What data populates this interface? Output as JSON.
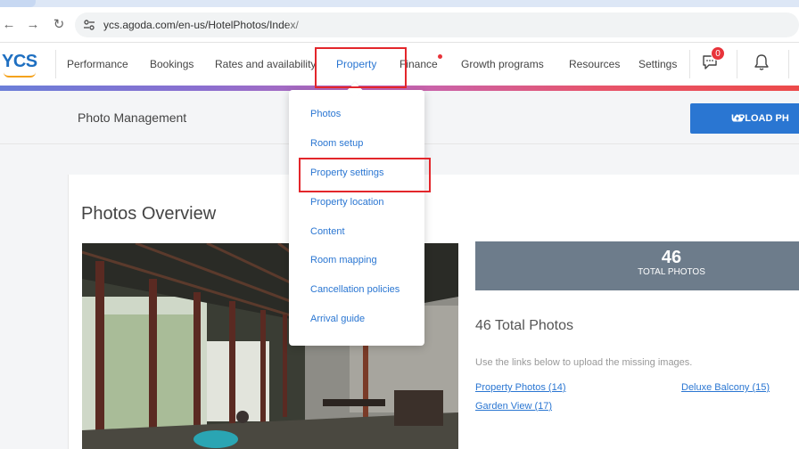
{
  "browser": {
    "url": "ycs.agoda.com/en-us/HotelPhotos/Index/",
    "url_obscured": "[partially obscured]"
  },
  "header": {
    "logo": "YCS",
    "nav": [
      {
        "label": "Performance"
      },
      {
        "label": "Bookings"
      },
      {
        "label": "Rates and availability"
      },
      {
        "label": "Property",
        "active": true
      },
      {
        "label": "Finance"
      },
      {
        "label": "Growth programs"
      },
      {
        "label": "Resources"
      },
      {
        "label": "Settings"
      }
    ],
    "chat_badge_count": "0",
    "icons": {
      "chat": "chat-icon",
      "bell": "bell-icon"
    }
  },
  "sub_header": {
    "title": "Photo Management",
    "upload_label": "UPLOAD PH"
  },
  "dropdown": {
    "items": [
      {
        "label": "Photos"
      },
      {
        "label": "Room setup"
      },
      {
        "label": "Property settings",
        "highlighted": true
      },
      {
        "label": "Property location"
      },
      {
        "label": "Content"
      },
      {
        "label": "Room mapping"
      },
      {
        "label": "Cancellation policies"
      },
      {
        "label": "Arrival guide"
      }
    ]
  },
  "overview": {
    "title": "Photos Overview",
    "total_number": "46",
    "total_label": "TOTAL PHOTOS",
    "heading": "46 Total Photos",
    "helper": "Use the links below to upload the missing images.",
    "links": [
      {
        "label": "Property Photos (14)"
      },
      {
        "label": "Deluxe Balcony (15)"
      },
      {
        "label": "Garden View (17)"
      }
    ]
  },
  "colors": {
    "accent": "#2a76d2",
    "highlight": "#e3262b",
    "total_box": "#6d7c8b",
    "badge": "#e8333a"
  }
}
